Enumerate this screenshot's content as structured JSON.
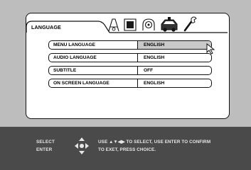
{
  "menu": {
    "title": "LANGUAGE",
    "items": [
      {
        "label": "MENU LANGUAGE",
        "value": "ENGLISH",
        "selected": true
      },
      {
        "label": "AUDIO LANGUAGE",
        "value": "ENGLISH",
        "selected": false
      },
      {
        "label": "SUBTITLE",
        "value": "OFF",
        "selected": false
      },
      {
        "label": "ON SCREEN LANGUAGE",
        "value": "ENGLISH",
        "selected": false
      }
    ]
  },
  "tabs": {
    "icons": [
      "speaker-icon",
      "screen-icon",
      "disc-icon",
      "car-icon",
      "wrench-icon"
    ]
  },
  "footer": {
    "keys": [
      "SELECT",
      "ENTER"
    ],
    "help_line1": "USE ▲▼◀▶ TO SELECT, USE ENTER TO CONFIRM",
    "help_line2": "TO EXET, PRESS CHOICE."
  },
  "colors": {
    "background": "#bdbdbd",
    "panel": "#ffffff",
    "footer": "#4a4a4a",
    "selected_value": "#c9c9c9"
  }
}
